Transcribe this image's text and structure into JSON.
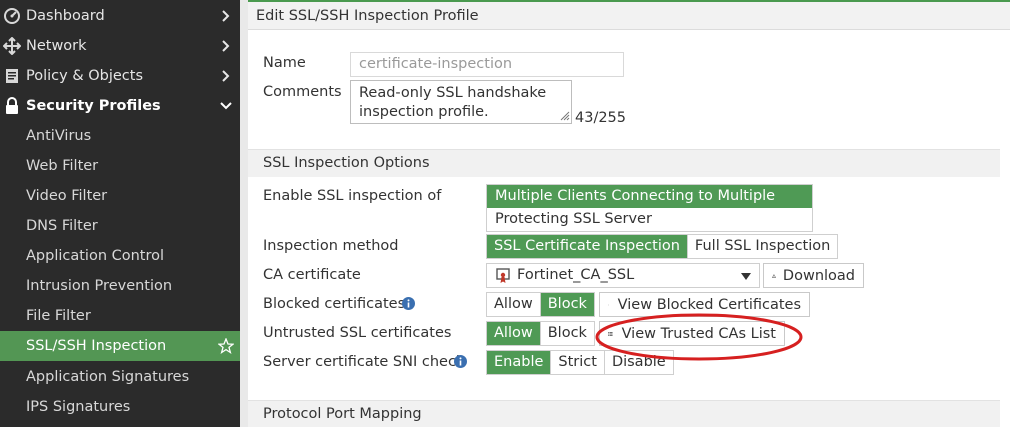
{
  "sidebar": {
    "items": [
      {
        "label": "Dashboard",
        "icon": "dashboard-icon"
      },
      {
        "label": "Network",
        "icon": "network-icon"
      },
      {
        "label": "Policy & Objects",
        "icon": "policy-icon"
      },
      {
        "label": "Security Profiles",
        "icon": "lock-icon"
      },
      {
        "label": "AntiVirus"
      },
      {
        "label": "Web Filter"
      },
      {
        "label": "Video Filter"
      },
      {
        "label": "DNS Filter"
      },
      {
        "label": "Application Control"
      },
      {
        "label": "Intrusion Prevention"
      },
      {
        "label": "File Filter"
      },
      {
        "label": "SSL/SSH Inspection"
      },
      {
        "label": "Application Signatures"
      },
      {
        "label": "IPS Signatures"
      }
    ]
  },
  "header": {
    "title": "Edit SSL/SSH Inspection Profile"
  },
  "form": {
    "name_label": "Name",
    "name_value": "certificate-inspection",
    "comments_label": "Comments",
    "comments_line1": "Read-only SSL handshake",
    "comments_line2": "inspection profile.",
    "comments_counter": "43/255"
  },
  "ssl_section": {
    "title": "SSL Inspection Options",
    "enable_label": "Enable SSL inspection of",
    "enable_options": [
      "Multiple Clients Connecting to Multiple Servers",
      "Protecting SSL Server"
    ],
    "method_label": "Inspection method",
    "method_options": [
      "SSL Certificate Inspection",
      "Full SSL Inspection"
    ],
    "ca_label": "CA certificate",
    "ca_value": "Fortinet_CA_SSL",
    "download_label": "Download",
    "blocked_label": "Blocked certificates",
    "blocked_options": [
      "Allow",
      "Block"
    ],
    "view_blocked_label": "View Blocked Certificates",
    "untrusted_label": "Untrusted SSL certificates",
    "untrusted_options": [
      "Allow",
      "Block"
    ],
    "view_trusted_label": "View Trusted CAs List",
    "sni_label": "Server certificate SNI check",
    "sni_options": [
      "Enable",
      "Strict",
      "Disable"
    ]
  },
  "port_section": {
    "title": "Protocol Port Mapping"
  },
  "colors": {
    "accent": "#4f9a55",
    "sidebar": "#2b2b2b",
    "annotation": "#d62020"
  }
}
